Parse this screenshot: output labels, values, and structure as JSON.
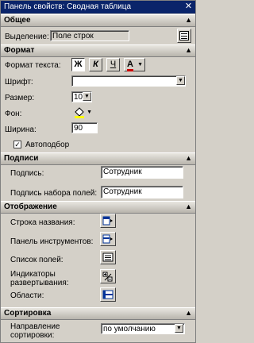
{
  "window": {
    "title": "Панель свойств: Сводная таблица",
    "close_glyph": "✕"
  },
  "sections": {
    "general": {
      "title": "Общее",
      "chevron": "▲"
    },
    "format": {
      "title": "Формат",
      "chevron": "▲"
    },
    "captions": {
      "title": "Подписи",
      "chevron": "▲"
    },
    "display": {
      "title": "Отображение",
      "chevron": "▲"
    },
    "sort": {
      "title": "Сортировка",
      "chevron": "▲"
    }
  },
  "general": {
    "selection_label": "Выделение:",
    "selection_value": "Поле строк",
    "more_button_icon": "field-list-icon"
  },
  "format": {
    "text_format_label": "Формат текста:",
    "bold_glyph": "Ж",
    "italic_glyph": "К",
    "underline_glyph": "Ч",
    "font_color_glyph": "A",
    "font_color": "#cc0000",
    "font_label": "Шрифт:",
    "font_value": "",
    "size_label": "Размер:",
    "size_value": "10",
    "fill_label": "Фон:",
    "fill_color": "#ffff00",
    "width_label": "Ширина:",
    "width_value": "90",
    "autofit_label": "Автоподбор",
    "autofit_checked": true
  },
  "captions": {
    "caption_label": "Подпись:",
    "caption_value": "Сотрудник",
    "fieldset_caption_label": "Подпись набора полей:",
    "fieldset_caption_value": "Сотрудник"
  },
  "display": {
    "title_bar_label": "Строка названия:",
    "toolbar_label": "Панель инструментов:",
    "field_list_label": "Список полей:",
    "expand_indicators_label": "Индикаторы развертывания:",
    "areas_label": "Области:"
  },
  "sort": {
    "direction_label": "Направление сортировки:",
    "direction_value": "по умолчанию"
  },
  "colors": {
    "titlebar": "#0a246a",
    "face": "#d4d0c8"
  }
}
